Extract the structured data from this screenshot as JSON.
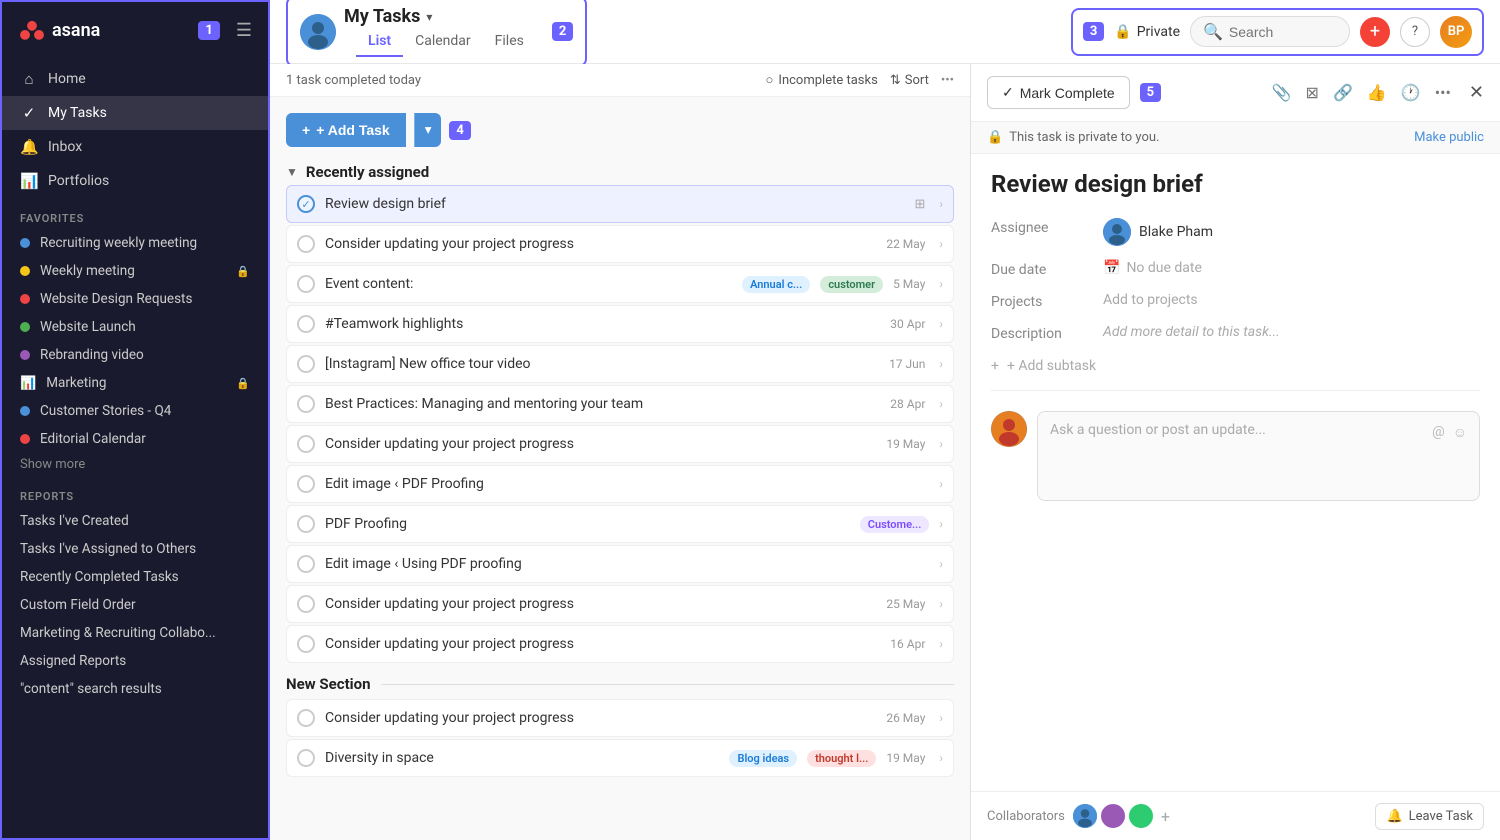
{
  "sidebar": {
    "logo_text": "asana",
    "badge1": "1",
    "nav": [
      {
        "label": "Home",
        "icon": "🏠"
      },
      {
        "label": "My Tasks",
        "icon": "✓"
      },
      {
        "label": "Inbox",
        "icon": "🔔"
      },
      {
        "label": "Portfolios",
        "icon": "📊"
      }
    ],
    "favorites_label": "Favorites",
    "favorites": [
      {
        "label": "Recruiting weekly meeting",
        "dot_class": "dot-blue"
      },
      {
        "label": "Weekly meeting",
        "dot_class": "dot-yellow",
        "lock": true
      },
      {
        "label": "Website Design Requests",
        "dot_class": "dot-red"
      },
      {
        "label": "Website Launch",
        "dot_class": "dot-green"
      },
      {
        "label": "Rebranding video",
        "dot_class": "dot-purple"
      },
      {
        "label": "Marketing",
        "dot_class": "dot-orange",
        "lock": true,
        "bar": true
      },
      {
        "label": "Customer Stories - Q4",
        "dot_class": "dot-blue"
      },
      {
        "label": "Editorial Calendar",
        "dot_class": "dot-red"
      }
    ],
    "show_more": "Show more",
    "reports_label": "Reports",
    "reports": [
      {
        "label": "Tasks I've Created"
      },
      {
        "label": "Tasks I've Assigned to Others"
      },
      {
        "label": "Recently Completed Tasks"
      },
      {
        "label": "Custom Field Order"
      },
      {
        "label": "Marketing & Recruiting Collabo..."
      },
      {
        "label": "Assigned Reports"
      },
      {
        "label": "\"content\" search results"
      }
    ]
  },
  "header": {
    "tab_label": "My Tasks",
    "badge2": "2",
    "tabs": [
      "List",
      "Calendar",
      "Files"
    ],
    "active_tab": "List",
    "subtitle": "1 task completed today",
    "badge3": "3",
    "private_label": "Private",
    "search_placeholder": "Search",
    "add_tooltip": "+",
    "help_label": "?",
    "incomplete_tasks_label": "Incomplete tasks",
    "sort_label": "Sort"
  },
  "task_list": {
    "add_task_label": "+ Add Task",
    "badge4": "4",
    "recently_assigned_label": "Recently assigned",
    "tasks": [
      {
        "name": "Review design brief",
        "date": "",
        "selected": true,
        "icon": "⊞"
      },
      {
        "name": "Consider updating your project progress",
        "date": "22 May"
      },
      {
        "name": "Event content:",
        "date": "5 May",
        "tags": [
          {
            "label": "Annual c...",
            "cls": "tag-blue"
          },
          {
            "label": "customer",
            "cls": "tag-green"
          }
        ]
      },
      {
        "name": "#Teamwork highlights",
        "date": "30 Apr"
      },
      {
        "name": "[Instagram] New office tour video",
        "date": "17 Jun"
      },
      {
        "name": "Best Practices: Managing and mentoring your team",
        "date": "28 Apr"
      },
      {
        "name": "Consider updating your project progress",
        "date": "19 May"
      },
      {
        "name": "Edit image  ‹ PDF Proofing",
        "date": ""
      },
      {
        "name": "PDF Proofing",
        "date": "",
        "tags": [
          {
            "label": "Custome...",
            "cls": "tag-purple"
          }
        ]
      },
      {
        "name": "Edit image  ‹ Using PDF proofing",
        "date": ""
      },
      {
        "name": "Consider updating your project progress",
        "date": "25 May"
      },
      {
        "name": "Consider updating your project progress",
        "date": "16 Apr"
      }
    ],
    "new_section_label": "New Section",
    "new_section_tasks": [
      {
        "name": "Consider updating your project progress",
        "date": "26 May"
      },
      {
        "name": "Diversity in space",
        "date": "19 May",
        "tags": [
          {
            "label": "Blog ideas",
            "cls": "tag-blue"
          },
          {
            "label": "thought l...",
            "cls": "tag-red"
          }
        ]
      }
    ]
  },
  "detail": {
    "mark_complete_label": "Mark Complete",
    "badge5": "5",
    "private_notice": "This task is private to you.",
    "make_public_label": "Make public",
    "title": "Review design brief",
    "assignee_label": "Assignee",
    "assignee_name": "Blake Pham",
    "due_date_label": "Due date",
    "due_date_value": "No due date",
    "projects_label": "Projects",
    "projects_value": "Add to projects",
    "description_label": "Description",
    "description_placeholder": "Add more detail to this task...",
    "add_subtask_label": "+ Add subtask",
    "comment_placeholder": "Ask a question or post an update...",
    "collaborators_label": "Collaborators",
    "leave_task_label": "Leave Task"
  }
}
